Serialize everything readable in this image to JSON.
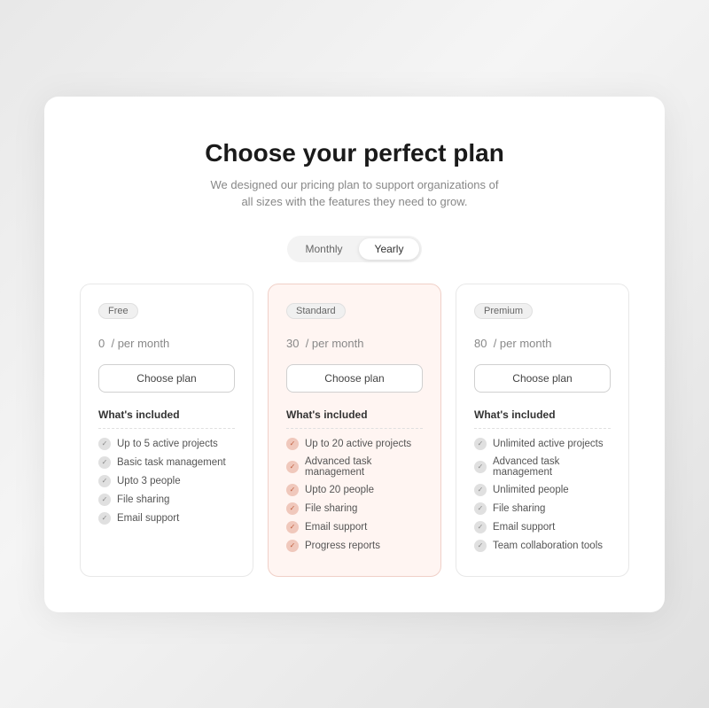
{
  "header": {
    "title": "Choose your perfect plan",
    "subtitle_line1": "We designed our pricing plan to support organizations of",
    "subtitle_line2": "all sizes with the features they need to grow."
  },
  "toggle": {
    "monthly_label": "Monthly",
    "yearly_label": "Yearly",
    "active": "yearly"
  },
  "plans": [
    {
      "id": "free",
      "badge": "Free",
      "price": "0",
      "price_suffix": "/ per month",
      "cta": "Choose plan",
      "features_title": "What's included",
      "features": [
        "Up to 5 active projects",
        "Basic task management",
        "Upto 3 people",
        "File sharing",
        "Email support"
      ],
      "highlighted": false
    },
    {
      "id": "standard",
      "badge": "Standard",
      "price": "30",
      "price_suffix": "/ per month",
      "cta": "Choose plan",
      "features_title": "What's included",
      "features": [
        "Up to 20 active projects",
        "Advanced task management",
        "Upto 20 people",
        "File sharing",
        "Email support",
        "Progress reports"
      ],
      "highlighted": true
    },
    {
      "id": "premium",
      "badge": "Premium",
      "price": "80",
      "price_suffix": "/ per month",
      "cta": "Choose plan",
      "features_title": "What's included",
      "features": [
        "Unlimited active projects",
        "Advanced task management",
        "Unlimited people",
        "File sharing",
        "Email support",
        "Team collaboration tools"
      ],
      "highlighted": false
    }
  ]
}
